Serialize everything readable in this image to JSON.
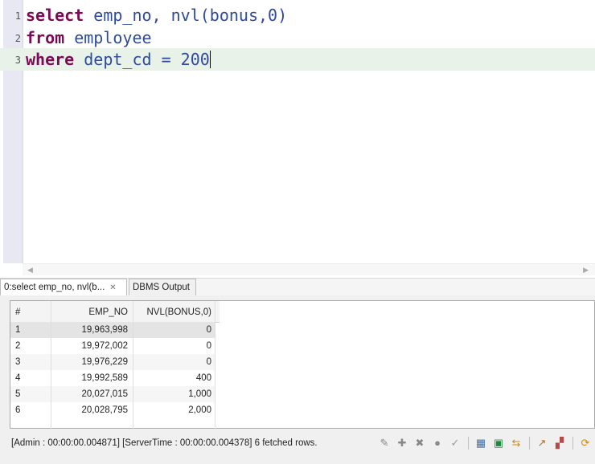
{
  "editor": {
    "lines": [
      {
        "num": "1",
        "kw": "select",
        "rest": " emp_no, nvl(bonus,0)"
      },
      {
        "num": "2",
        "kw": "from",
        "rest": " employee"
      },
      {
        "num": "3",
        "kw": "where",
        "rest": " dept_cd = 200"
      }
    ]
  },
  "tabs": {
    "result": "0:select emp_no, nvl(b...",
    "result_close": "✕",
    "dbms": "DBMS Output"
  },
  "grid": {
    "headers": [
      "#",
      "EMP_NO",
      "NVL(BONUS,0)"
    ],
    "rows": [
      [
        "1",
        "19,963,998",
        "0"
      ],
      [
        "2",
        "19,972,002",
        "0"
      ],
      [
        "3",
        "19,976,229",
        "0"
      ],
      [
        "4",
        "19,992,589",
        "400"
      ],
      [
        "5",
        "20,027,015",
        "1,000"
      ],
      [
        "6",
        "20,028,795",
        "2,000"
      ]
    ]
  },
  "status": {
    "text": "[Admin : 00:00:00.004871] [ServerTime : 00:00:00.004378]   6 fetched rows."
  },
  "icons": {
    "edit": "✎",
    "add": "✚",
    "delete": "✖",
    "stop": "●",
    "apply": "✓",
    "table": "▦",
    "excel": "▣",
    "transfer": "⇆",
    "export": "↗",
    "chart": "▞",
    "refresh": "⟳"
  }
}
